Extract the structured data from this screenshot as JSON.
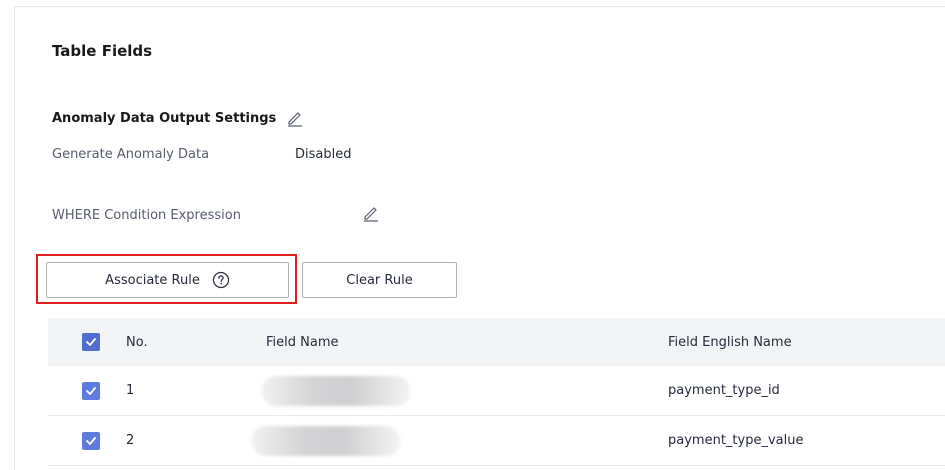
{
  "section": {
    "title": "Table Fields"
  },
  "anomaly_settings": {
    "title": "Anomaly Data Output Settings",
    "generate_label": "Generate Anomaly Data",
    "generate_value": "Disabled",
    "where_label": "WHERE Condition Expression"
  },
  "buttons": {
    "associate_rule": "Associate Rule",
    "clear_rule": "Clear Rule"
  },
  "table": {
    "columns": [
      "No.",
      "Field Name",
      "Field English Name"
    ],
    "header_checked": true,
    "rows": [
      {
        "checked": true,
        "no": "1",
        "field_name_redacted": true,
        "field_english_name": "payment_type_id"
      },
      {
        "checked": true,
        "no": "2",
        "field_name_redacted": true,
        "field_english_name": "payment_type_value"
      }
    ]
  },
  "icons": {
    "edit": "pencil-icon",
    "help": "question-circle-icon",
    "check": "checkmark-icon"
  },
  "colors": {
    "checkbox": "#5e7ce0",
    "highlight_border": "#e02020"
  }
}
